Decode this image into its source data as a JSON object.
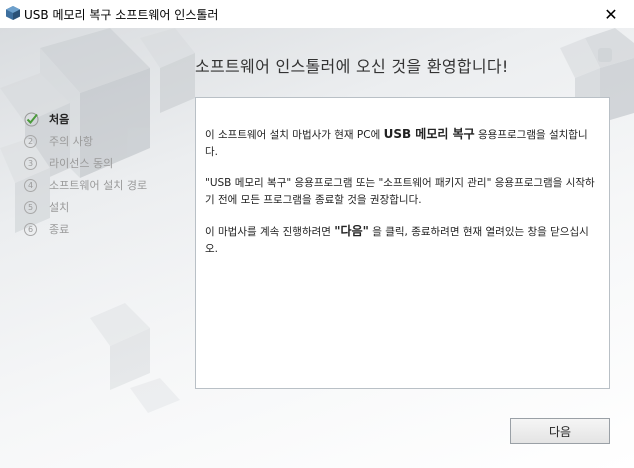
{
  "window": {
    "title": "USB 메모리 복구 소프트웨어 인스톨러",
    "close_glyph": "✕"
  },
  "heading": "소프트웨어 인스톨러에 오신 것을 환영합니다!",
  "steps": [
    {
      "number": "",
      "label": "처음",
      "state": "done"
    },
    {
      "number": "2",
      "label": "주의 사항",
      "state": "pending"
    },
    {
      "number": "3",
      "label": "라이선스 동의",
      "state": "pending"
    },
    {
      "number": "4",
      "label": "소프트웨어 설치 경로",
      "state": "pending"
    },
    {
      "number": "5",
      "label": "설치",
      "state": "pending"
    },
    {
      "number": "6",
      "label": "종료",
      "state": "pending"
    }
  ],
  "content": {
    "p1_pre": "이 소프트웨어 설치 마법사가 현재 PC에 ",
    "p1_bold": "USB 메모리 복구",
    "p1_post": " 응용프로그램을 설치합니다.",
    "p2": "\"USB 메모리 복구\" 응용프로그램 또는 \"소프트웨어 패키지 관리\" 응용프로그램을 시작하기 전에 모든 프로그램을 종료할 것을 권장합니다.",
    "p3_pre": "이 마법사를 계속 진행하려면 ",
    "p3_bold": "\"다음\"",
    "p3_post": " 을 클릭, 종료하려면 현재 열려있는 창을 닫으십시오."
  },
  "buttons": {
    "next_label": "다음"
  },
  "colors": {
    "accent_check": "#4a9a3a",
    "box_border": "#b9c0c6"
  }
}
